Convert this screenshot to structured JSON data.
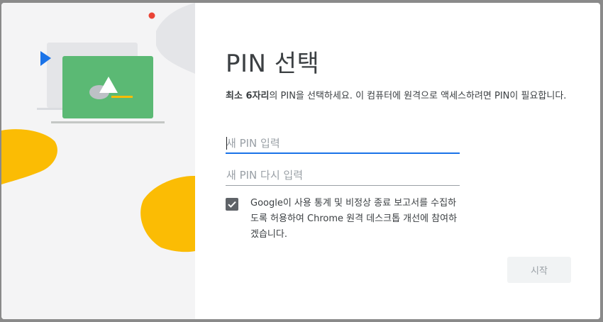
{
  "dialog": {
    "title": "PIN 선택",
    "description_bold": "최소 6자리",
    "description_rest": "의 PIN을 선택하세요. 이 컴퓨터에 원격으로 액세스하려면 PIN이 필요합니다.",
    "new_pin_placeholder": "새 PIN 입력",
    "confirm_pin_placeholder": "새 PIN 다시 입력",
    "consent_checked": true,
    "consent_text": "Google이 사용 통계 및 비정상 종료 보고서를 수집하도록 허용하여 Chrome 원격 데스크톱 개선에 참여하겠습니다.",
    "start_label": "시작"
  },
  "icons": {
    "illustration": "remote-desktop-illustration",
    "checkbox": "check-icon"
  },
  "colors": {
    "accent": "#1a73e8",
    "illustration_green": "#5bb974",
    "illustration_yellow": "#fbbc04",
    "illustration_red": "#ea4335",
    "illustration_blue": "#1a73e8"
  }
}
